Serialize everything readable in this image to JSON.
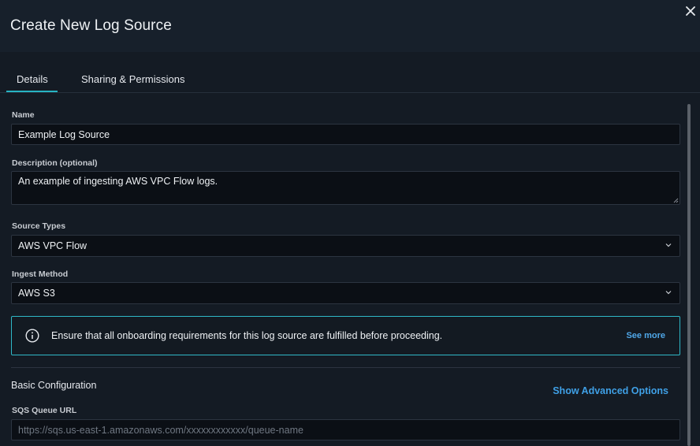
{
  "dialog": {
    "title": "Create New Log Source",
    "close_icon": "close-icon"
  },
  "tabs": [
    {
      "label": "Details",
      "active": true
    },
    {
      "label": "Sharing & Permissions",
      "active": false
    }
  ],
  "form": {
    "name": {
      "label": "Name",
      "value": "Example Log Source"
    },
    "description": {
      "label": "Description (optional)",
      "value": "An example of ingesting AWS VPC Flow logs."
    },
    "source_types": {
      "label": "Source Types",
      "value": "AWS VPC Flow"
    },
    "ingest_method": {
      "label": "Ingest Method",
      "value": "AWS S3"
    }
  },
  "notice": {
    "icon": "info-icon",
    "message": "Ensure that all onboarding requirements for this log source are fulfilled before proceeding.",
    "link": "See more"
  },
  "basic_config": {
    "title": "Basic Configuration",
    "advanced_link": "Show Advanced Options",
    "sqs_label": "SQS Queue URL",
    "sqs_placeholder": "https://sqs.us-east-1.amazonaws.com/xxxxxxxxxxxx/queue-name"
  },
  "colors": {
    "accent_teal": "#27b4c3",
    "link_blue": "#3fa0e6",
    "background": "#141b24"
  }
}
